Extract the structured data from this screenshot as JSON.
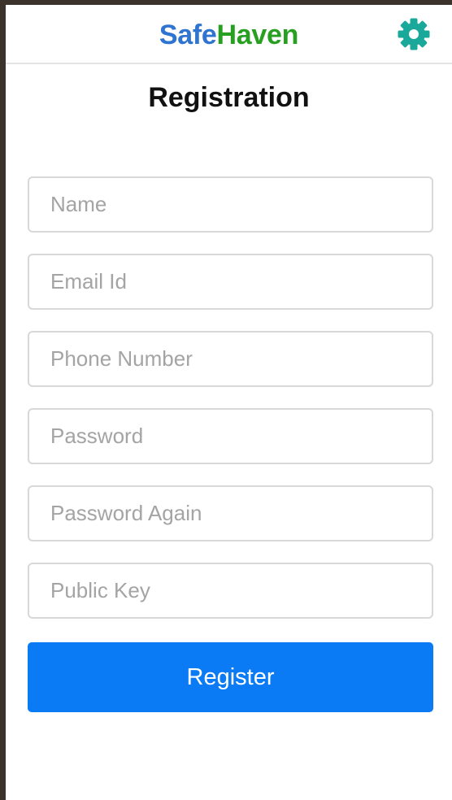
{
  "header": {
    "brand_part_1": "Safe",
    "brand_part_2": "Haven",
    "settings_icon": "gear-icon",
    "brand_colors": {
      "safe": "#2f74d0",
      "haven": "#27a022",
      "gear": "#1aa89b"
    }
  },
  "page": {
    "title": "Registration"
  },
  "form": {
    "name_placeholder": "Name",
    "email_placeholder": "Email Id",
    "phone_placeholder": "Phone Number",
    "password_placeholder": "Password",
    "password_again_placeholder": "Password Again",
    "public_key_placeholder": "Public Key",
    "register_label": "Register",
    "button_color": "#0a7bf5"
  }
}
